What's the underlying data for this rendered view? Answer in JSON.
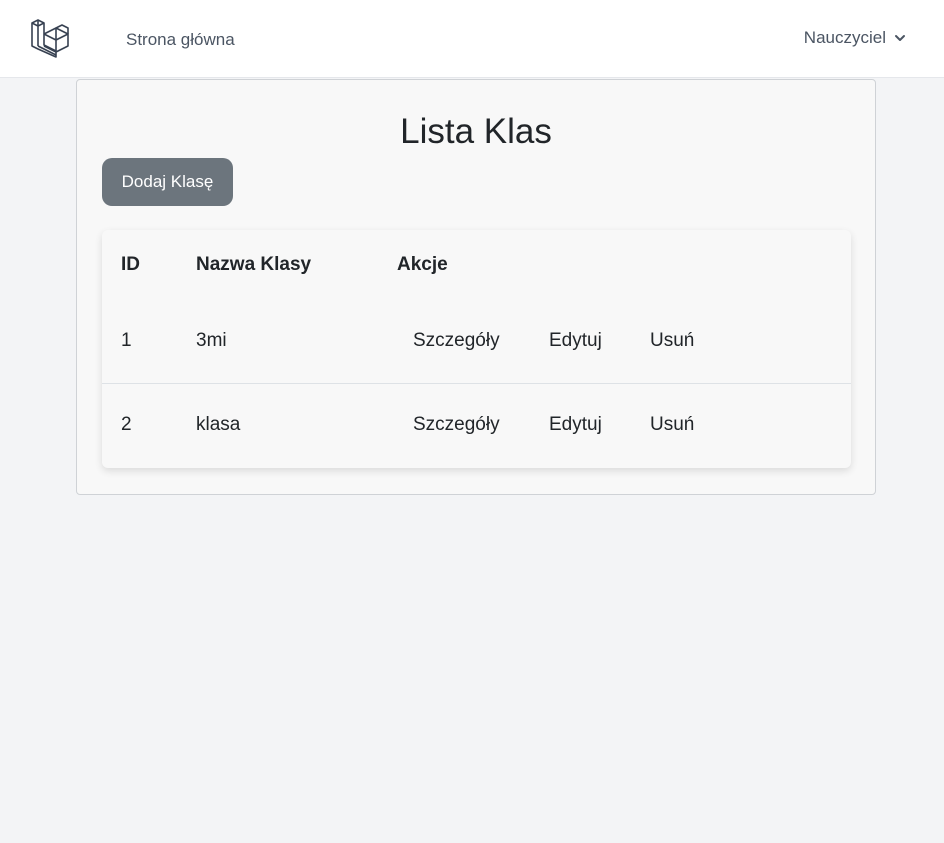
{
  "nav": {
    "home_link": "Strona główna",
    "user_menu": "Nauczyciel"
  },
  "page": {
    "title": "Lista Klas",
    "add_button": "Dodaj Klasę"
  },
  "table": {
    "headers": [
      "ID",
      "Nazwa Klasy",
      "Akcje"
    ],
    "rows": [
      {
        "id": "1",
        "name": "3mi",
        "details": "Szczegóły",
        "edit": "Edytuj",
        "delete": "Usuń"
      },
      {
        "id": "2",
        "name": "klasa",
        "details": "Szczegóły",
        "edit": "Edytuj",
        "delete": "Usuń"
      }
    ]
  },
  "icons": {
    "logo": "laravel-logo-icon",
    "user_menu_toggle": "chevron-down-icon"
  },
  "colors": {
    "button_bg": "#6c757d",
    "page_bg": "#f3f4f6",
    "card_bg": "#f8f8f8"
  }
}
